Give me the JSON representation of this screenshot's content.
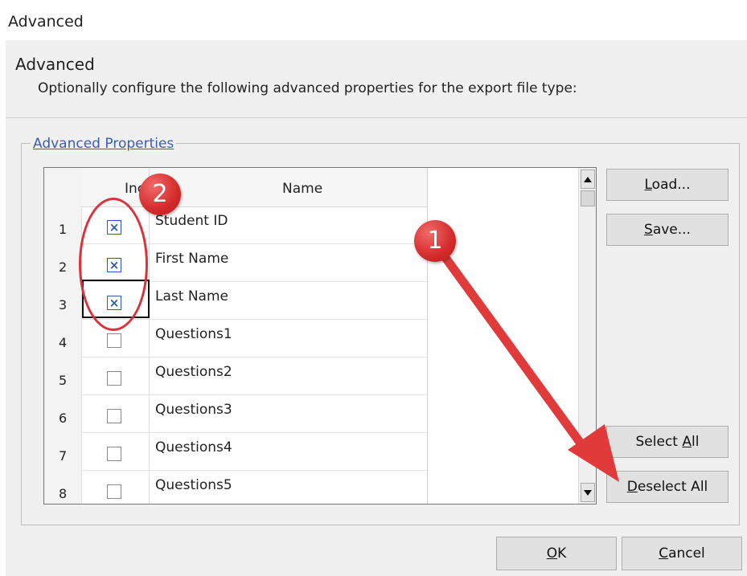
{
  "window": {
    "title": "Advanced"
  },
  "header": {
    "title": "Advanced",
    "subtitle": "Optionally configure the following advanced properties for the export file type:"
  },
  "group": {
    "label": "Advanced Properties"
  },
  "grid": {
    "columns": {
      "include": "Includ",
      "name": "Name"
    },
    "rows": [
      {
        "num": "1",
        "checked": true,
        "check_glyph": "×",
        "name": "Student ID"
      },
      {
        "num": "2",
        "checked": true,
        "check_glyph": "×",
        "name": "First Name"
      },
      {
        "num": "3",
        "checked": true,
        "check_glyph": "×",
        "name": "Last Name"
      },
      {
        "num": "4",
        "checked": false,
        "check_glyph": "",
        "name": "Questions1"
      },
      {
        "num": "5",
        "checked": false,
        "check_glyph": "",
        "name": "Questions2"
      },
      {
        "num": "6",
        "checked": false,
        "check_glyph": "",
        "name": "Questions3"
      },
      {
        "num": "7",
        "checked": false,
        "check_glyph": "",
        "name": "Questions4"
      },
      {
        "num": "8",
        "checked": false,
        "check_glyph": "",
        "name": "Questions5"
      }
    ]
  },
  "buttons": {
    "load": {
      "acc": "L",
      "rest": "oad..."
    },
    "save": {
      "acc": "S",
      "rest": "ave..."
    },
    "select_all": {
      "pre": "Select ",
      "acc": "A",
      "rest": "ll"
    },
    "deselect_all": {
      "acc": "D",
      "rest": "eselect All"
    },
    "ok": {
      "acc": "O",
      "rest": "K"
    },
    "cancel": {
      "acc": "C",
      "rest": "ancel"
    }
  },
  "annotations": {
    "badge_1": "1",
    "badge_2": "2",
    "color": "#d9323a"
  }
}
